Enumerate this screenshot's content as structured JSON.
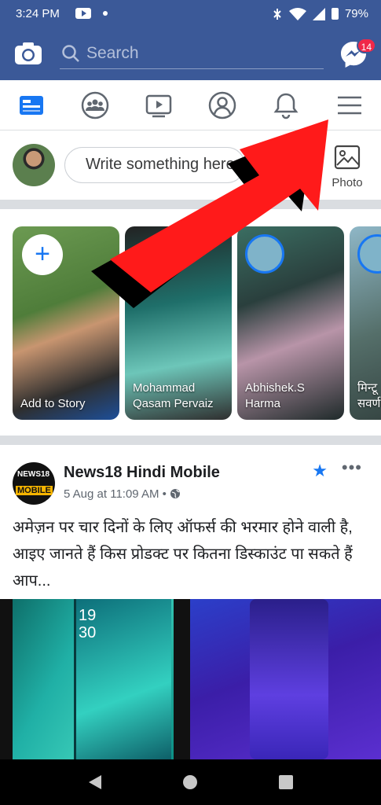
{
  "status_bar": {
    "time": "3:24 PM",
    "battery": "79%"
  },
  "top_bar": {
    "search_placeholder": "Search",
    "messenger_badge": "14"
  },
  "nav_tabs": [
    "news-feed",
    "groups",
    "watch",
    "profile",
    "notifications",
    "menu"
  ],
  "composer": {
    "placeholder": "Write something here",
    "photo_label": "Photo"
  },
  "stories": [
    {
      "label": "Add to Story"
    },
    {
      "label": "Mohammad Qasam Pervaiz"
    },
    {
      "label": "Abhishek.S Harma"
    },
    {
      "label": "मिन्टू सवर्ण"
    }
  ],
  "post": {
    "page_name": "News18 Hindi Mobile",
    "timestamp": "5 Aug at 11:09 AM",
    "text": "अमेज़न पर चार दिनों के लिए ऑफर्स की भरमार होने वाली है, आइए जानते हैं किस प्रोडक्ट पर कितना डिस्काउंट पा सकते हैं आप...",
    "logo_text_1": "NEWS18",
    "logo_text_2": "MOBILE",
    "image_text_1": "19",
    "image_text_2": "30"
  },
  "colors": {
    "brand": "#3b5998",
    "accent": "#1877f2",
    "arrow": "#ff1a1a"
  }
}
